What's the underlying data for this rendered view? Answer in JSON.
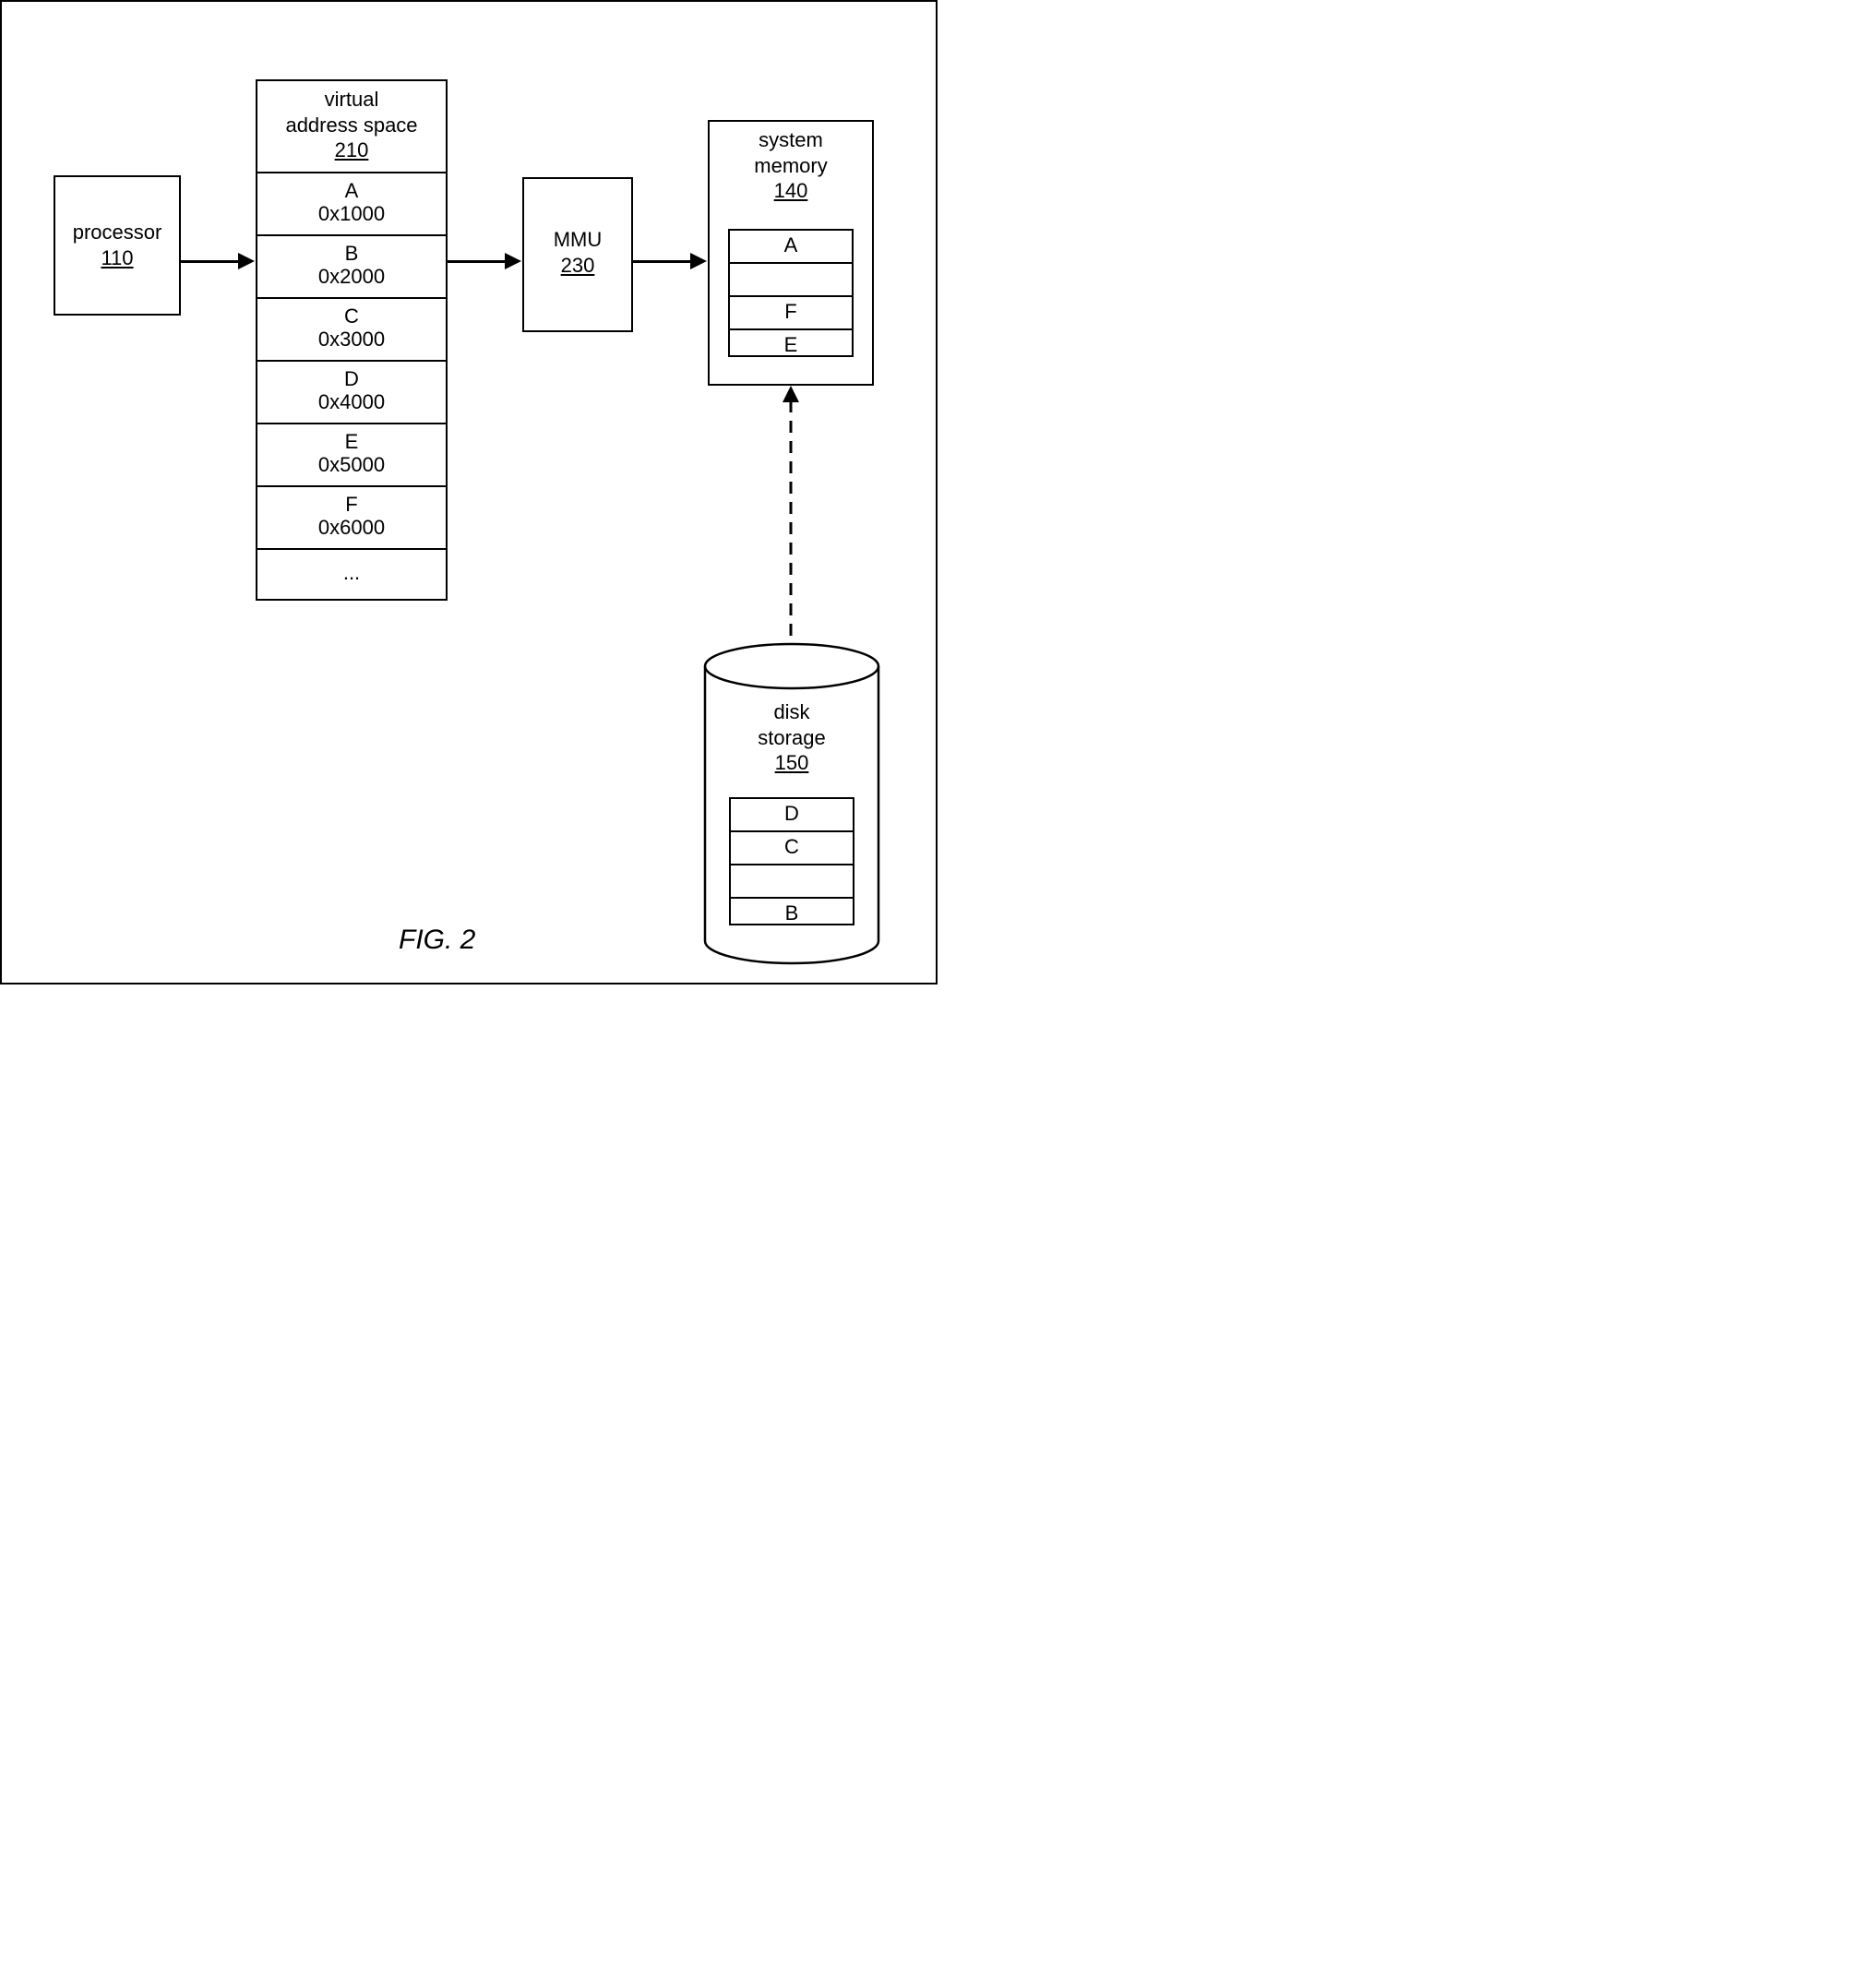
{
  "processor": {
    "label": "processor",
    "ref": "110"
  },
  "vspace": {
    "label": "virtual\naddress space",
    "ref": "210",
    "rows": [
      {
        "letter": "A",
        "addr": "0x1000"
      },
      {
        "letter": "B",
        "addr": "0x2000"
      },
      {
        "letter": "C",
        "addr": "0x3000"
      },
      {
        "letter": "D",
        "addr": "0x4000"
      },
      {
        "letter": "E",
        "addr": "0x5000"
      },
      {
        "letter": "F",
        "addr": "0x6000"
      }
    ],
    "more": "..."
  },
  "mmu": {
    "label": "MMU",
    "ref": "230"
  },
  "memory": {
    "label": "system\nmemory",
    "ref": "140",
    "rows": [
      "A",
      "",
      "F",
      "E"
    ]
  },
  "disk": {
    "label": "disk\nstorage",
    "ref": "150",
    "rows": [
      "D",
      "C",
      "",
      "B"
    ]
  },
  "caption": "FIG. 2"
}
